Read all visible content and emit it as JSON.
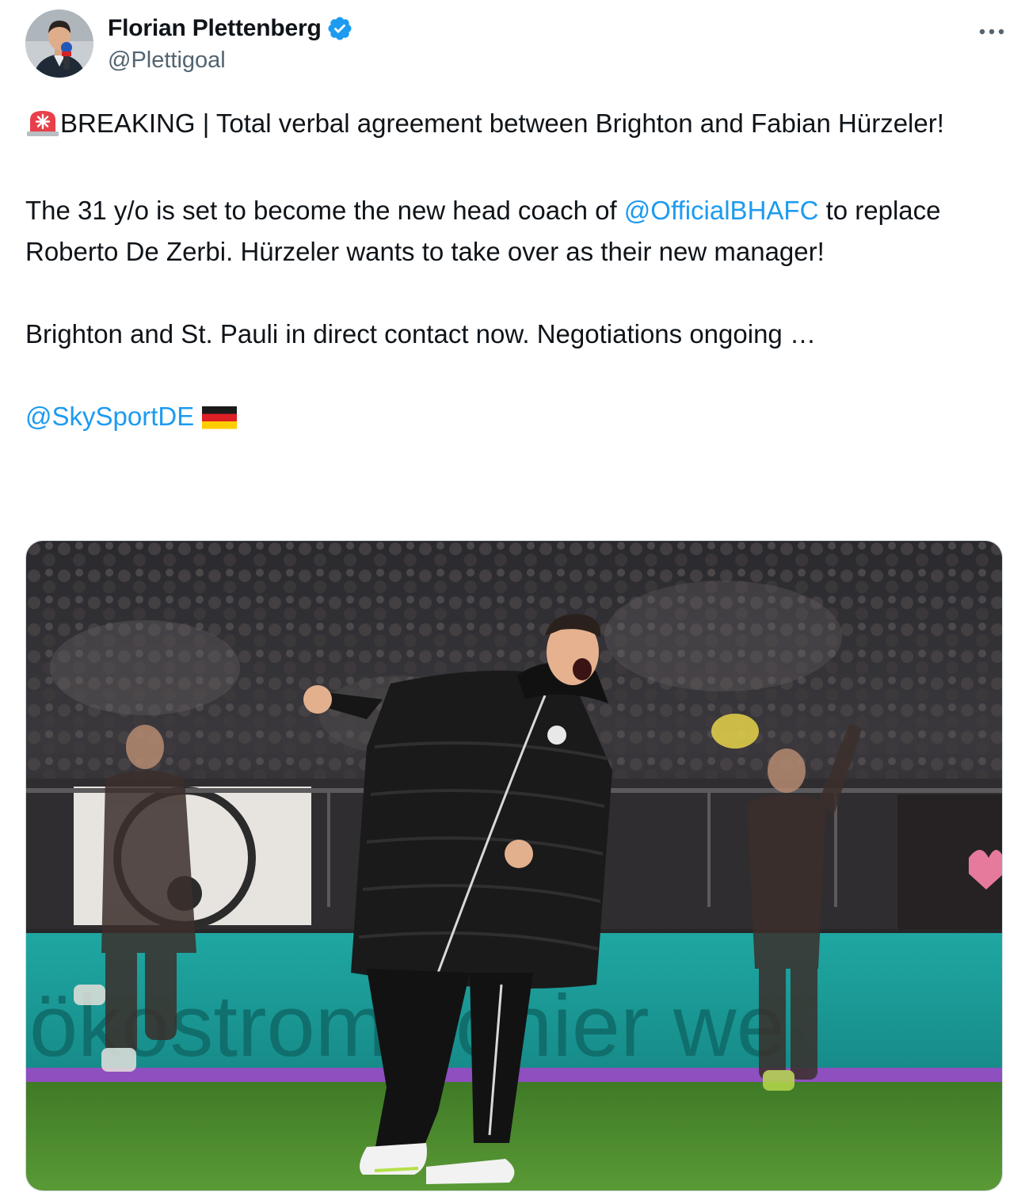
{
  "author": {
    "display_name": "Florian Plettenberg",
    "handle": "@Plettigoal",
    "verified": true,
    "avatar_icon": "avatar-person-microphone"
  },
  "more_icon": "more-horizontal-icon",
  "tweet": {
    "line1_emoji": "rotating-light-emoji",
    "line1_text": "BREAKING | Total verbal agreement between Brighton and Fabian Hürzeler!",
    "para2_before": "The 31 y/o is set to become the new head coach of ",
    "para2_mention": "@OfficialBHAFC",
    "para2_after": " to replace Roberto De Zerbi. Hürzeler wants to take over as their new manager!",
    "para3": "Brighton and St. Pauli in direct contact now. Negotiations ongoing …",
    "para4_mention": "@SkySportDE",
    "para4_emoji": "germany-flag-emoji"
  },
  "media": {
    "board_text": "ökostrompionier we",
    "accent_colors": {
      "board": "#1fa7a2",
      "pitch": "#4d8a2e",
      "stripe": "#8e4fbf"
    }
  },
  "colors": {
    "link": "#1d9bf0",
    "text": "#0f1419",
    "secondary": "#536471",
    "verified": "#1d9bf0"
  }
}
